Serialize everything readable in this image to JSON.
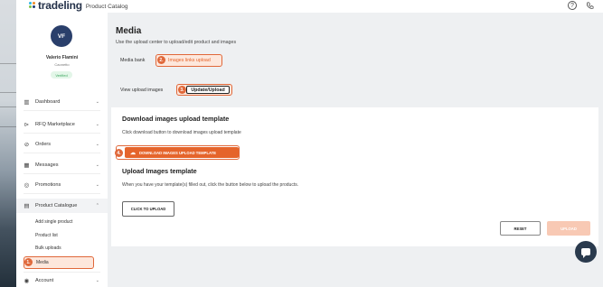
{
  "app": {
    "logo_text": "tradeling",
    "logo_subtitle": "Product Catalog",
    "logo_dot_colors": [
      "#2bb5e6",
      "#f28c28",
      "#7dc242",
      "#1f3b73"
    ]
  },
  "header": {
    "help_icon": "help-circle-icon",
    "phone_icon": "phone-icon"
  },
  "user": {
    "initials": "VF",
    "name": "Valerio Flamini",
    "company": "Caonetto",
    "status": "Verified"
  },
  "sidebar": {
    "items": [
      {
        "label": "Dashboard",
        "icon": "dashboard-icon"
      },
      {
        "label": "RFQ Marketplace",
        "icon": "rfq-icon"
      },
      {
        "label": "Orders",
        "icon": "orders-icon"
      },
      {
        "label": "Messages",
        "icon": "messages-icon"
      },
      {
        "label": "Promotions",
        "icon": "promotions-icon"
      },
      {
        "label": "Product Catalogue",
        "icon": "catalogue-icon"
      },
      {
        "label": "Account",
        "icon": "account-icon"
      }
    ],
    "subitems": [
      "Add single product",
      "Product list",
      "Bulk uploads",
      "Media"
    ],
    "media_step": "1."
  },
  "main": {
    "title": "Media",
    "description": "Use the upload center to upload/edit product and images",
    "media_bank_label": "Media bank",
    "images_link_tab": "Images links upload",
    "images_link_step": "2.",
    "view_upload_label": "View upload images",
    "update_upload_tab": "Update/Upload",
    "update_upload_step": "3."
  },
  "card": {
    "download_title": "Download images upload template",
    "download_text": "Click download button to download images upload template",
    "download_button": "DOWNLOAD IMAGES UPLOAD TEMPLATE",
    "download_step": "4.",
    "upload_title": "Upload Images template",
    "upload_text": "When you have your template(s) filled out, click the button below to upload the products.",
    "click_to_upload": "CLICK TO UPLOAD",
    "reset": "RESET",
    "upload": "UPLOAD"
  },
  "colors": {
    "accent": "#e5642b",
    "accent_light": "#fde7dc",
    "avatar": "#2a3f6b",
    "verified": "#3aa55d"
  }
}
